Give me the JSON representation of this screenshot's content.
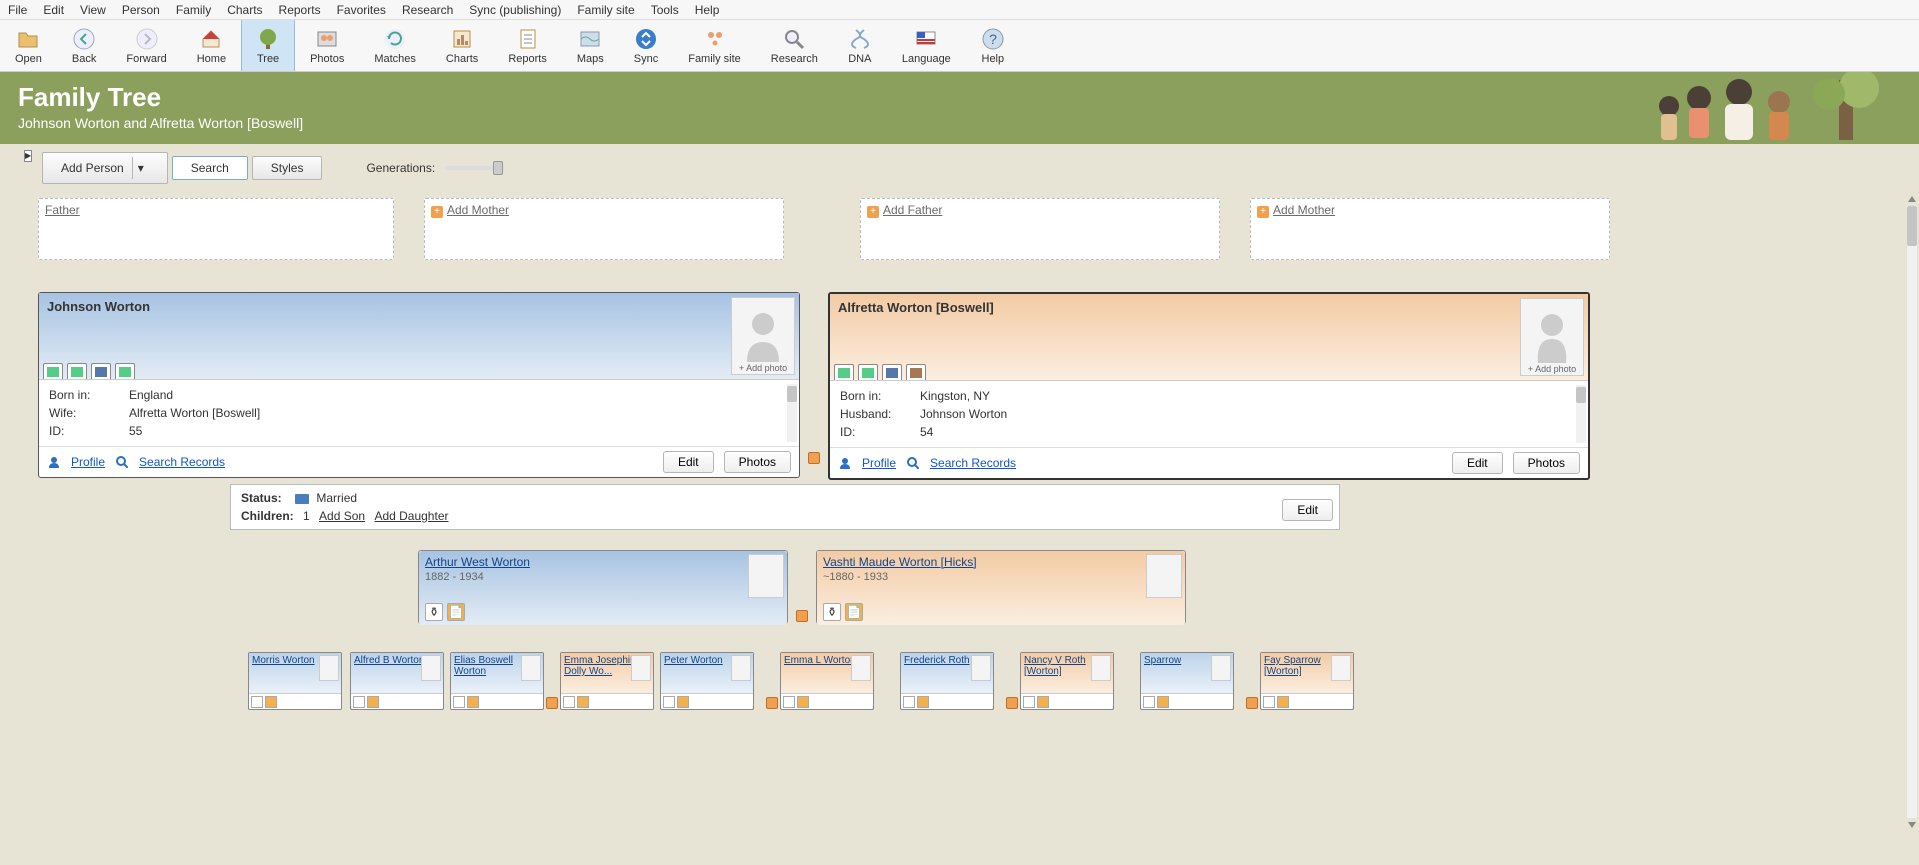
{
  "menu": [
    "File",
    "Edit",
    "View",
    "Person",
    "Family",
    "Charts",
    "Reports",
    "Favorites",
    "Research",
    "Sync (publishing)",
    "Family site",
    "Tools",
    "Help"
  ],
  "toolbar": [
    {
      "label": "Open",
      "icon": "folder"
    },
    {
      "label": "Back",
      "icon": "arrow-left"
    },
    {
      "label": "Forward",
      "icon": "arrow-right"
    },
    {
      "label": "Home",
      "icon": "house"
    },
    {
      "label": "Tree",
      "icon": "tree",
      "active": true
    },
    {
      "label": "Photos",
      "icon": "photos"
    },
    {
      "label": "Matches",
      "icon": "refresh"
    },
    {
      "label": "Charts",
      "icon": "chart"
    },
    {
      "label": "Reports",
      "icon": "report"
    },
    {
      "label": "Maps",
      "icon": "map"
    },
    {
      "label": "Sync",
      "icon": "sync"
    },
    {
      "label": "Family site",
      "icon": "family"
    },
    {
      "label": "Research",
      "icon": "search"
    },
    {
      "label": "DNA",
      "icon": "dna"
    },
    {
      "label": "Language",
      "icon": "flag"
    },
    {
      "label": "Help",
      "icon": "help"
    }
  ],
  "header": {
    "title": "Family Tree",
    "subtitle": "Johnson Worton and Alfretta Worton [Boswell]"
  },
  "controls": {
    "add_person": "Add Person",
    "search": "Search",
    "styles": "Styles",
    "generations": "Generations:"
  },
  "placeholders": {
    "father1": "Father",
    "add_mother1": "Add Mother",
    "add_father2": "Add Father",
    "add_mother2": "Add Mother"
  },
  "husband": {
    "name": "Johnson Worton",
    "born_label": "Born in:",
    "born": "England",
    "spouse_label": "Wife:",
    "spouse": "Alfretta Worton [Boswell]",
    "id_label": "ID:",
    "id": "55",
    "add_photo": "+ Add photo",
    "profile": "Profile",
    "search_records": "Search Records",
    "edit": "Edit",
    "photos": "Photos"
  },
  "wife": {
    "name": "Alfretta Worton [Boswell]",
    "born_label": "Born in:",
    "born": "Kingston, NY",
    "spouse_label": "Husband:",
    "spouse": "Johnson Worton",
    "id_label": "ID:",
    "id": "54",
    "add_photo": "+ Add photo",
    "profile": "Profile",
    "search_records": "Search Records",
    "edit": "Edit",
    "photos": "Photos"
  },
  "status": {
    "status_label": "Status:",
    "status": "Married",
    "children_label": "Children:",
    "count": "1",
    "add_son": "Add Son",
    "add_daughter": "Add Daughter",
    "edit": "Edit"
  },
  "child1": {
    "name": "Arthur West Worton",
    "dates": "1882 - 1934"
  },
  "child1_spouse": {
    "name": "Vashti Maude Worton [Hicks]",
    "dates": "~1880 - 1933"
  },
  "grandchildren": [
    {
      "name": "Morris Worton",
      "gender": "male"
    },
    {
      "name": "Alfred B Worton",
      "gender": "male"
    },
    {
      "name": "Elias Boswell Worton",
      "gender": "male"
    },
    {
      "name": "Emma Josephine Dolly Wo...",
      "gender": "female"
    },
    {
      "name": "Peter Worton",
      "gender": "male"
    },
    {
      "name": "Emma L Worton",
      "gender": "female"
    },
    {
      "name": "Frederick Roth",
      "gender": "male"
    },
    {
      "name": "Nancy V Roth [Worton]",
      "gender": "female"
    },
    {
      "name": "Sparrow",
      "gender": "male"
    },
    {
      "name": "Fay Sparrow [Worton]",
      "gender": "female"
    }
  ]
}
